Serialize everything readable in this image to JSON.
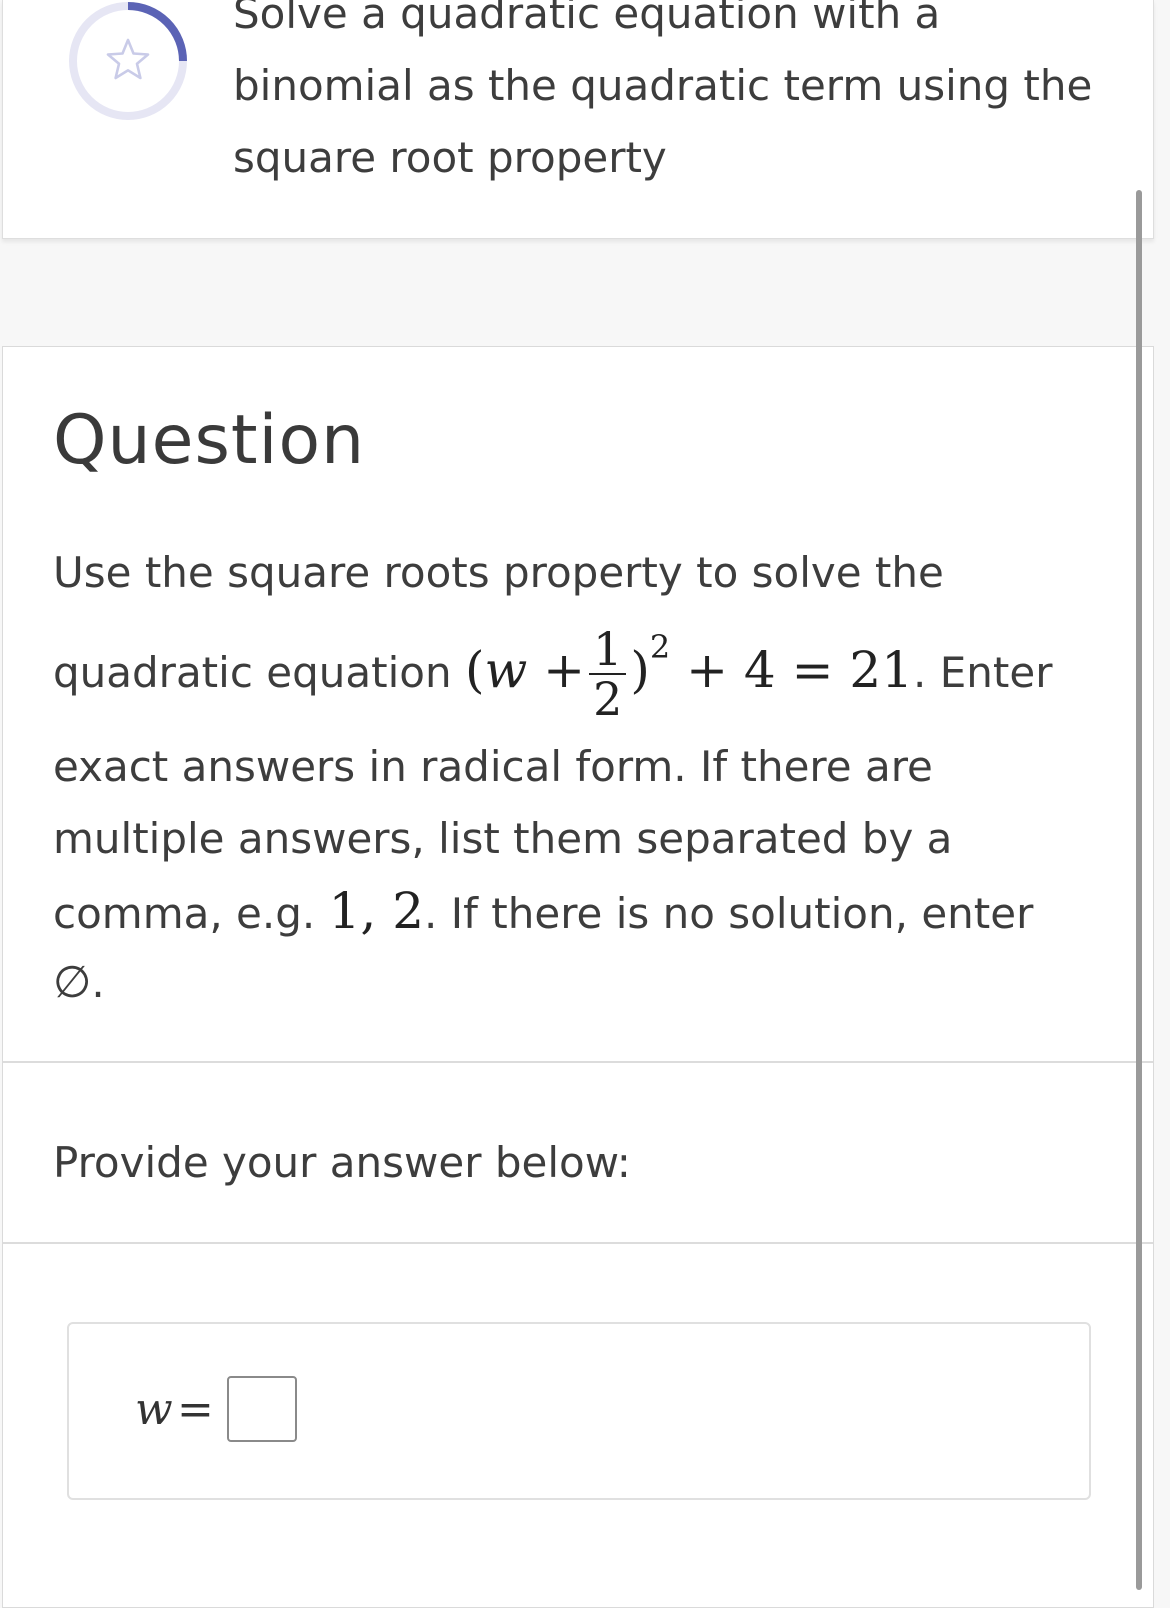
{
  "skill": {
    "title": "Solve a quadratic equation with a binomial as the quadratic term using the square root property",
    "progress_color": "#5b63b5",
    "track_color": "#e6e6f4",
    "star_icon": "star-icon"
  },
  "question": {
    "heading": "Question",
    "line1": "Use the square roots property to solve the",
    "line2_prefix": "quadratic equation",
    "equation": {
      "open": "(",
      "variable": "w",
      "plus": "+",
      "frac_num": "1",
      "frac_den": "2",
      "close": ")",
      "exponent": "2",
      "rest": "+ 4 = 21"
    },
    "line2_suffix": ". Enter",
    "line3": "exact answers in radical form. If there are",
    "line4": "multiple answers, list them separated by a",
    "line5_prefix": "comma, e.g.",
    "example": "1, 2",
    "line5_suffix": ". If there is no solution, enter",
    "emptyset": "∅",
    "line6_suffix": "."
  },
  "answer": {
    "prompt": "Provide your answer below:",
    "variable": "w",
    "equals": "=",
    "value": ""
  }
}
